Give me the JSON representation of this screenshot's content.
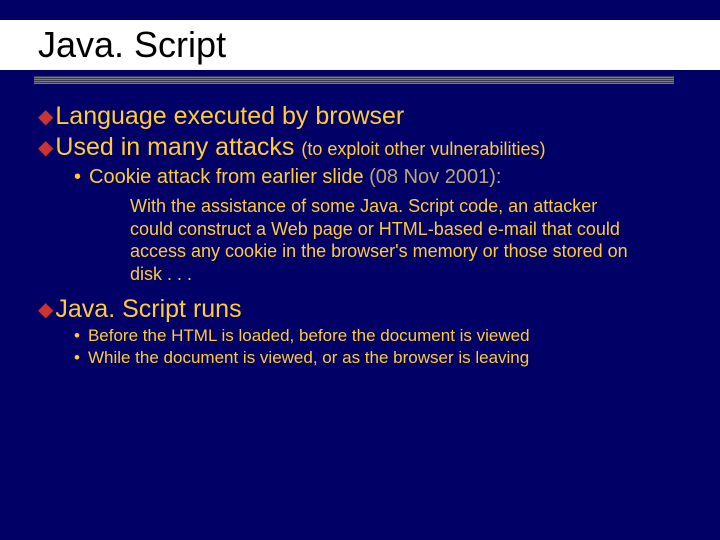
{
  "title": "Java. Script",
  "bullets": {
    "b1": "Language executed by browser",
    "b2_main": "Used in many attacks ",
    "b2_paren": "(to exploit other vulnerabilities)",
    "b2_sub1_a": "Cookie attack from earlier slide ",
    "b2_sub1_b": "(08 Nov 2001):",
    "b2_sub1_detail": " With the assistance of some Java. Script code, an attacker could construct a Web page or HTML-based e-mail that could access any cookie in the browser's memory or those stored on disk . . .",
    "b3": "Java. Script runs",
    "b3_sub1": "Before the HTML is loaded, before the document is viewed",
    "b3_sub2": "While the document is viewed, or as the browser is leaving"
  },
  "glyphs": {
    "diamond": "◆",
    "bullet": "•"
  }
}
